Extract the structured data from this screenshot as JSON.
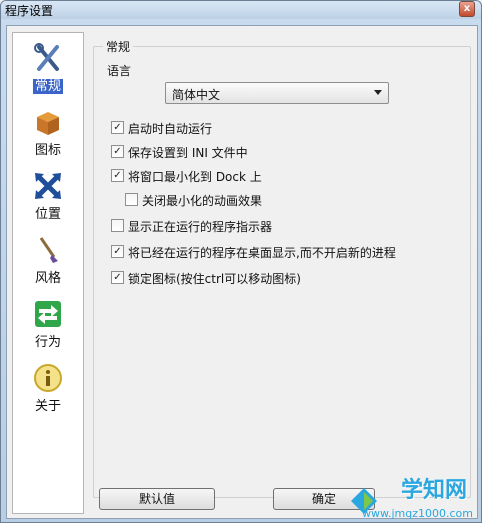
{
  "window": {
    "title": "程序设置",
    "close_glyph": "x"
  },
  "sidebar": {
    "items": [
      {
        "label": "常规",
        "icon": "tools-icon",
        "selected": true
      },
      {
        "label": "图标",
        "icon": "box-icon"
      },
      {
        "label": "位置",
        "icon": "move-icon"
      },
      {
        "label": "风格",
        "icon": "brush-icon"
      },
      {
        "label": "行为",
        "icon": "arrows-icon"
      },
      {
        "label": "关于",
        "icon": "info-icon"
      }
    ]
  },
  "general": {
    "group_title": "常规",
    "language_label": "语言",
    "language_value": "简体中文",
    "options": [
      {
        "label": "启动时自动运行",
        "checked": true
      },
      {
        "label": "保存设置到 INI 文件中",
        "checked": true
      },
      {
        "label": "将窗口最小化到 Dock 上",
        "checked": true
      },
      {
        "label": "关闭最小化的动画效果",
        "checked": false
      },
      {
        "label": "显示正在运行的程序指示器",
        "checked": false
      },
      {
        "label": "将已经在运行的程序在桌面显示,而不开启新的进程",
        "checked": true
      },
      {
        "label": "锁定图标(按住ctrl可以移动图标)",
        "checked": true
      }
    ]
  },
  "buttons": {
    "default": "默认值",
    "ok": "确定"
  },
  "watermark": {
    "main": "学知网",
    "sub": "www.jmqz1000.com"
  },
  "check_glyph": "✓"
}
